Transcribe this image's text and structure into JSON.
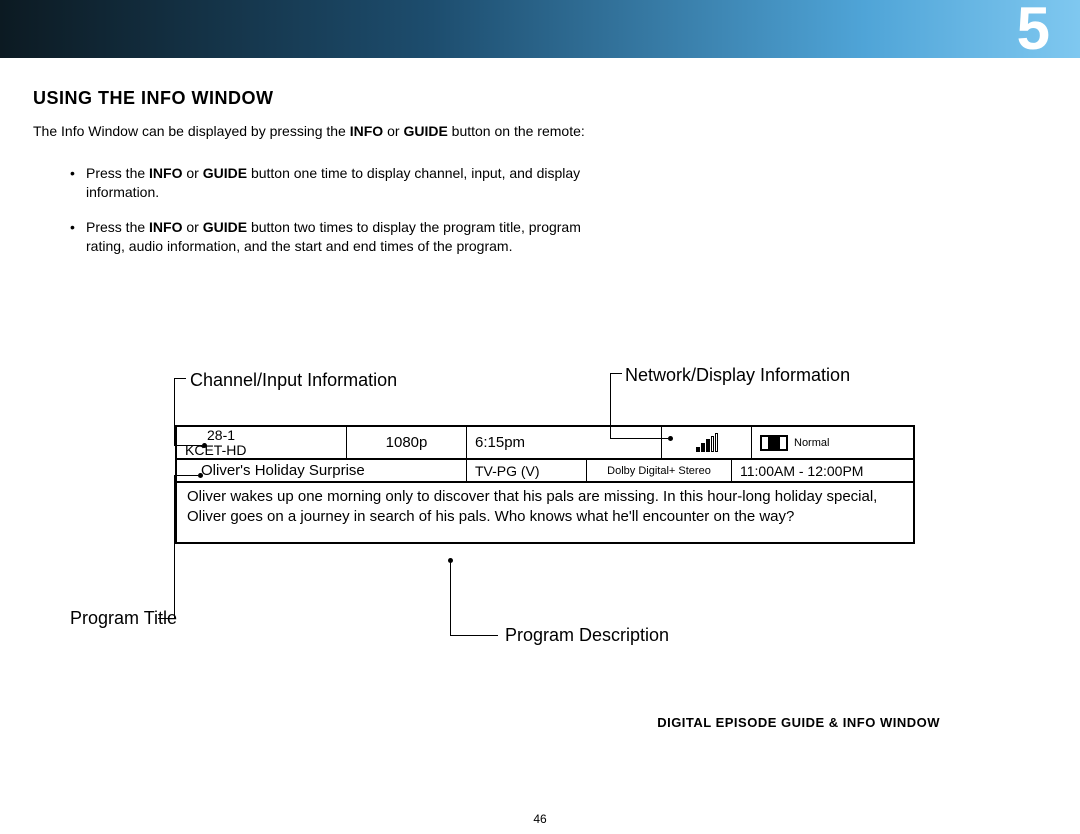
{
  "page_number": "5",
  "section_title": "USING THE INFO WINDOW",
  "intro_pre": "The Info Window can be displayed by pressing the ",
  "intro_btn1": "INFO",
  "intro_or": " or ",
  "intro_btn2": "GUIDE",
  "intro_post": " button on the remote:",
  "bullet1_pre": "Press the ",
  "bullet1_b1": "INFO",
  "bullet1_or": " or ",
  "bullet1_b2": "GUIDE",
  "bullet1_post": " button one time to display channel, input, and display information.",
  "bullet2_pre": "Press the ",
  "bullet2_b1": "INFO",
  "bullet2_or": " or ",
  "bullet2_b2": "GUIDE",
  "bullet2_post": " button two times to display the program title, program rating, audio information, and the start and end times of the program.",
  "annot_channel": "Channel/Input Information",
  "annot_network": "Network/Display Information",
  "annot_title": "Program Title",
  "annot_desc": "Program Description",
  "info": {
    "channel_num": "28-1",
    "channel_name": "KCET-HD",
    "resolution": "1080p",
    "time": "6:15pm",
    "aspect": "Normal",
    "program": "Oliver's Holiday Surprise",
    "rating": "TV-PG (V)",
    "audio": "Dolby Digital+ Stereo",
    "times": "11:00AM - 12:00PM",
    "description": "Oliver wakes up one morning only to discover that his pals are missing. In this hour-long holiday special, Oliver goes on a journey in search of his pals. Who knows what he'll encounter on the way?"
  },
  "footer_title": "DIGITAL EPISODE GUIDE & INFO WINDOW",
  "footer_page": "46"
}
